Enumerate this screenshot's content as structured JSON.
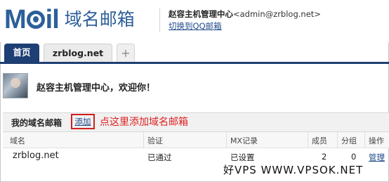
{
  "logo": {
    "mark_left": "M",
    "mark_right": "il",
    "subtitle": "域名邮箱"
  },
  "account": {
    "name": "赵容主机管理中心",
    "email": "<admin@zrblog.net>",
    "switch_link": "切换到QQ邮箱"
  },
  "tabs": [
    {
      "label": "首页",
      "active": true
    },
    {
      "label": "zrblog.net",
      "active": false
    },
    {
      "label": "+",
      "active": false
    }
  ],
  "welcome": {
    "text": "赵容主机管理中心，欢迎你！"
  },
  "domains": {
    "title": "我的域名邮箱",
    "add_label": "添加",
    "annotation": "点这里添加域名邮箱",
    "columns": [
      "域名",
      "验证",
      "MX记录",
      "成员",
      "分组",
      "操作"
    ],
    "rows": [
      {
        "domain": "zrblog.net",
        "verify": "已通过",
        "mx": "已设置",
        "members": "2",
        "groups": "0",
        "action": "管理"
      }
    ]
  },
  "watermark": "好VPS WWW.VPSOK.NET",
  "colors": {
    "brand": "#2d5f9a",
    "tab_active": "#1e3f73",
    "annotation": "#e01f1f",
    "link": "#1f4a8a"
  }
}
